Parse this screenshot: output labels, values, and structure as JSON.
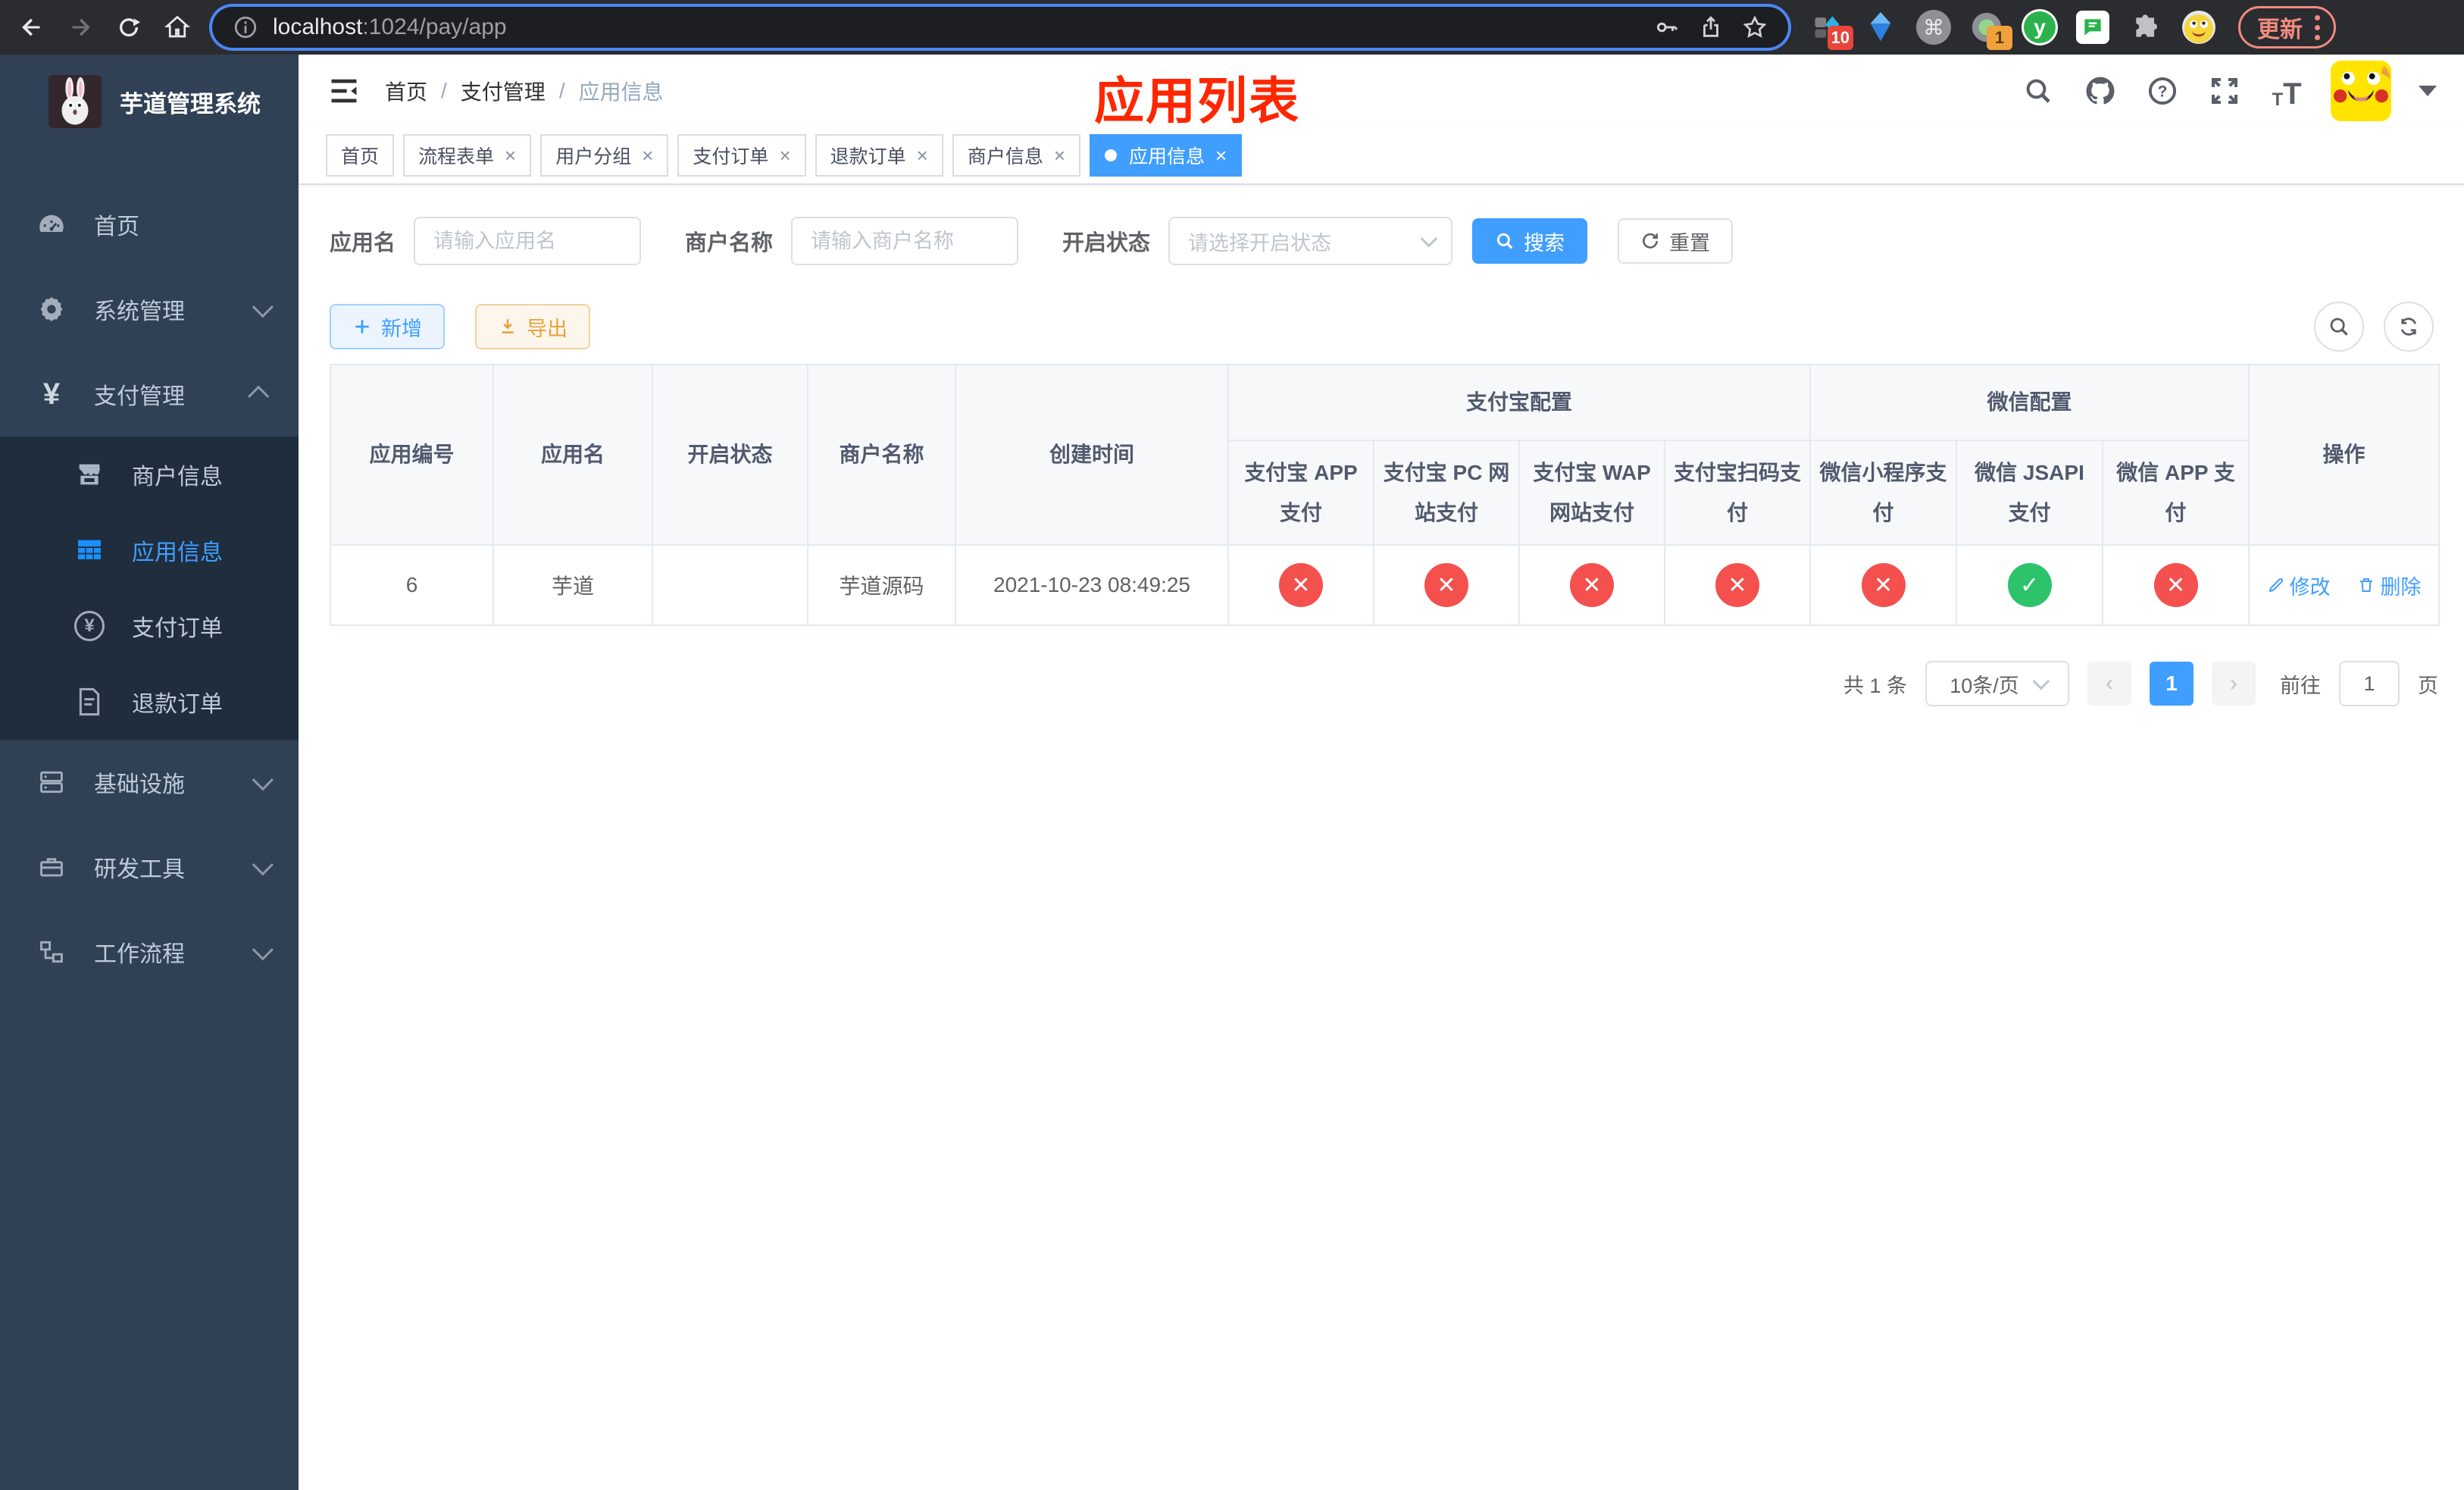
{
  "browser": {
    "url_host": "localhost",
    "url_path": ":1024/pay/app",
    "update_button": "更新",
    "extension_badges": {
      "diamond": "10",
      "proxy": "1"
    },
    "ext_y_label": "y"
  },
  "colors": {
    "accent_blue": "#409eff",
    "annotation_red": "#ff2600",
    "success_green": "#2cc36b",
    "danger_red": "#f4504e",
    "sidebar_bg": "#304156",
    "submenu_bg": "#1f2d3d"
  },
  "sidebar": {
    "title": "芋道管理系统",
    "menu": [
      {
        "label": "首页"
      },
      {
        "label": "系统管理"
      },
      {
        "label": "支付管理"
      },
      {
        "label": "基础设施"
      },
      {
        "label": "研发工具"
      },
      {
        "label": "工作流程"
      }
    ],
    "submenu": [
      {
        "label": "商户信息"
      },
      {
        "label": "应用信息"
      },
      {
        "label": "支付订单"
      },
      {
        "label": "退款订单"
      }
    ]
  },
  "topbar": {
    "breadcrumb": [
      "首页",
      "支付管理",
      "应用信息"
    ],
    "annotation": "应用列表"
  },
  "tabs": [
    {
      "label": "首页"
    },
    {
      "label": "流程表单"
    },
    {
      "label": "用户分组"
    },
    {
      "label": "支付订单"
    },
    {
      "label": "退款订单"
    },
    {
      "label": "商户信息"
    },
    {
      "label": "应用信息"
    }
  ],
  "filter": {
    "app_name_label": "应用名",
    "app_name_placeholder": "请输入应用名",
    "merchant_label": "商户名称",
    "merchant_placeholder": "请输入商户名称",
    "status_label": "开启状态",
    "status_placeholder": "请选择开启状态",
    "search_button": "搜索",
    "reset_button": "重置"
  },
  "toolbar": {
    "add_button": "新增",
    "export_button": "导出"
  },
  "table": {
    "columns": [
      "应用编号",
      "应用名",
      "开启状态",
      "商户名称",
      "创建时间"
    ],
    "groups": [
      {
        "label": "支付宝配置"
      },
      {
        "label": "微信配置"
      }
    ],
    "subcolumns": [
      "支付宝 APP 支付",
      "支付宝 PC 网站支付",
      "支付宝 WAP 网站支付",
      "支付宝扫码支付",
      "微信小程序支付",
      "微信 JSAPI 支付",
      "微信 APP 支付"
    ],
    "actions_column": "操作",
    "rows": [
      {
        "id": "6",
        "name": "芋道",
        "enabled": true,
        "merchant": "芋道源码",
        "created": "2021-10-23 08:49:25",
        "pay_status": [
          "no",
          "no",
          "no",
          "no",
          "no",
          "yes",
          "no"
        ],
        "edit_label": "修改",
        "delete_label": "删除"
      }
    ]
  },
  "pagination": {
    "total": "共 1 条",
    "page_size": "10条/页",
    "current_page": "1",
    "goto_label": "前往",
    "goto_value": "1",
    "page_suffix": "页"
  }
}
